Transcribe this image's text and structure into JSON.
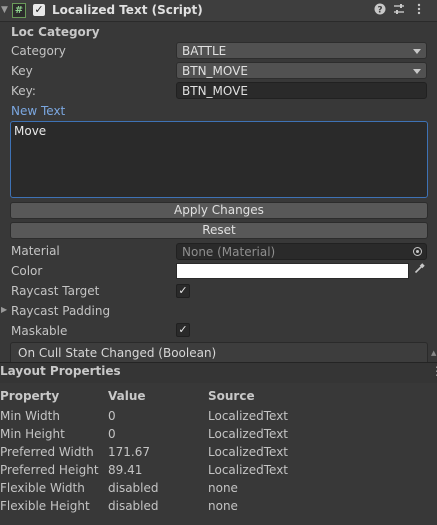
{
  "component": {
    "title": "Localized Text (Script)",
    "fold_icon": "triangle-down-icon",
    "script_icon_glyph": "#",
    "enabled_check": "✓",
    "header_icons": [
      "help-icon",
      "preset-icon",
      "kebab-menu-icon"
    ]
  },
  "loc": {
    "section": "Loc Category",
    "category_label": "Category",
    "category_value": "BATTLE",
    "key_dropdown_label": "Key",
    "key_dropdown_value": "BTN_MOVE",
    "key_field_label": "Key:",
    "key_field_value": "BTN_MOVE",
    "new_text_label": "New Text",
    "new_text_value": "Move",
    "apply_button": "Apply Changes",
    "reset_button": "Reset"
  },
  "graphic": {
    "material_label": "Material",
    "material_value": "None (Material)",
    "color_label": "Color",
    "color_value": "#ffffff",
    "raycast_target_label": "Raycast Target",
    "raycast_target_checked": "✓",
    "raycast_padding_label": "Raycast Padding",
    "maskable_label": "Maskable",
    "maskable_checked": "✓",
    "event_label": "On Cull State Changed (Boolean)"
  },
  "layout": {
    "title": "Layout Properties",
    "menu_glyph": "⋮",
    "headers": [
      "Property",
      "Value",
      "Source"
    ],
    "rows": [
      [
        "Min Width",
        "0",
        "LocalizedText"
      ],
      [
        "Min Height",
        "0",
        "LocalizedText"
      ],
      [
        "Preferred Width",
        "171.67",
        "LocalizedText"
      ],
      [
        "Preferred Height",
        "89.41",
        "LocalizedText"
      ],
      [
        "Flexible Width",
        "disabled",
        "none"
      ],
      [
        "Flexible Height",
        "disabled",
        "none"
      ]
    ]
  },
  "colors": {
    "panel_bg": "#383838",
    "accent_blue": "#7ba7e0",
    "focus_border": "#3e72b5"
  }
}
